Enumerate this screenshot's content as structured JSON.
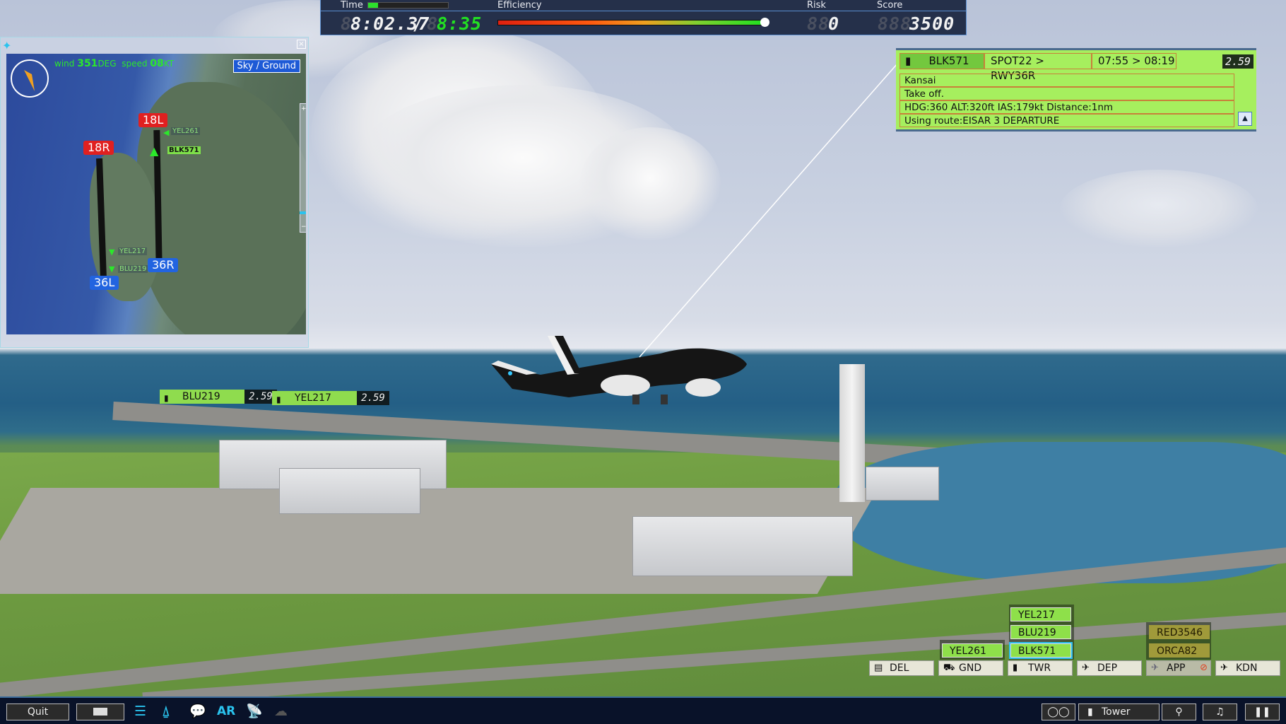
{
  "hud": {
    "time_label": "Time",
    "time_progress": 0.12,
    "time_value": "8:02.37",
    "time_separator": "/",
    "time_limit": "8:35",
    "efficiency_label": "Efficiency",
    "efficiency_value": 0.97,
    "risk_label": "Risk",
    "risk_value": "0",
    "risk_ghost": "88",
    "score_label": "Score",
    "score_value": "3500",
    "score_ghost": "888",
    "time_ghost": "8",
    "limit_ghost": "8"
  },
  "selected_flight": {
    "callsign": "BLK571",
    "route": "SPOT22 > RWY36R",
    "schedule": "07:55 > 08:19",
    "timer": "2.59",
    "lines": [
      "Kansai",
      "Take off.",
      "HDG:360 ALT:320ft IAS:179kt Distance:1nm",
      "Using route:EISAR 3 DEPARTURE"
    ],
    "accent": "#a6ef5e"
  },
  "radar": {
    "wind_label": "wind",
    "wind_dir": "351",
    "wind_dir_unit": "DEG",
    "speed_label": "speed",
    "wind_speed": "08",
    "speed_unit": "KT",
    "toggle_label": "Sky / Ground",
    "zoom_level": 0.08,
    "runways": [
      "18L",
      "18R",
      "36R",
      "36L"
    ],
    "aircraft": [
      {
        "callsign": "YEL261"
      },
      {
        "callsign": "BLK571"
      },
      {
        "callsign": "YEL217"
      },
      {
        "callsign": "BLU219"
      }
    ]
  },
  "world_tags": [
    {
      "callsign": "BLU219",
      "timer": "2.59"
    },
    {
      "callsign": "YEL217",
      "timer": "2.59"
    }
  ],
  "controllers": {
    "GND": [
      "YEL261"
    ],
    "TWR": [
      "YEL217",
      "BLU219",
      "BLK571"
    ],
    "APP": [
      "RED3546",
      "ORCA82"
    ],
    "buttons": [
      {
        "label": "DEL",
        "icon": "document-icon"
      },
      {
        "label": "GND",
        "icon": "vehicle-icon"
      },
      {
        "label": "TWR",
        "icon": "tower-icon"
      },
      {
        "label": "DEP",
        "icon": "departure-plane-icon"
      },
      {
        "label": "APP",
        "icon": "approach-plane-icon"
      },
      {
        "label": "KDN",
        "icon": "jet-icon"
      }
    ]
  },
  "bottom_bar": {
    "quit_label": "Quit",
    "ar_label": "AR",
    "view_label": "Tower"
  }
}
